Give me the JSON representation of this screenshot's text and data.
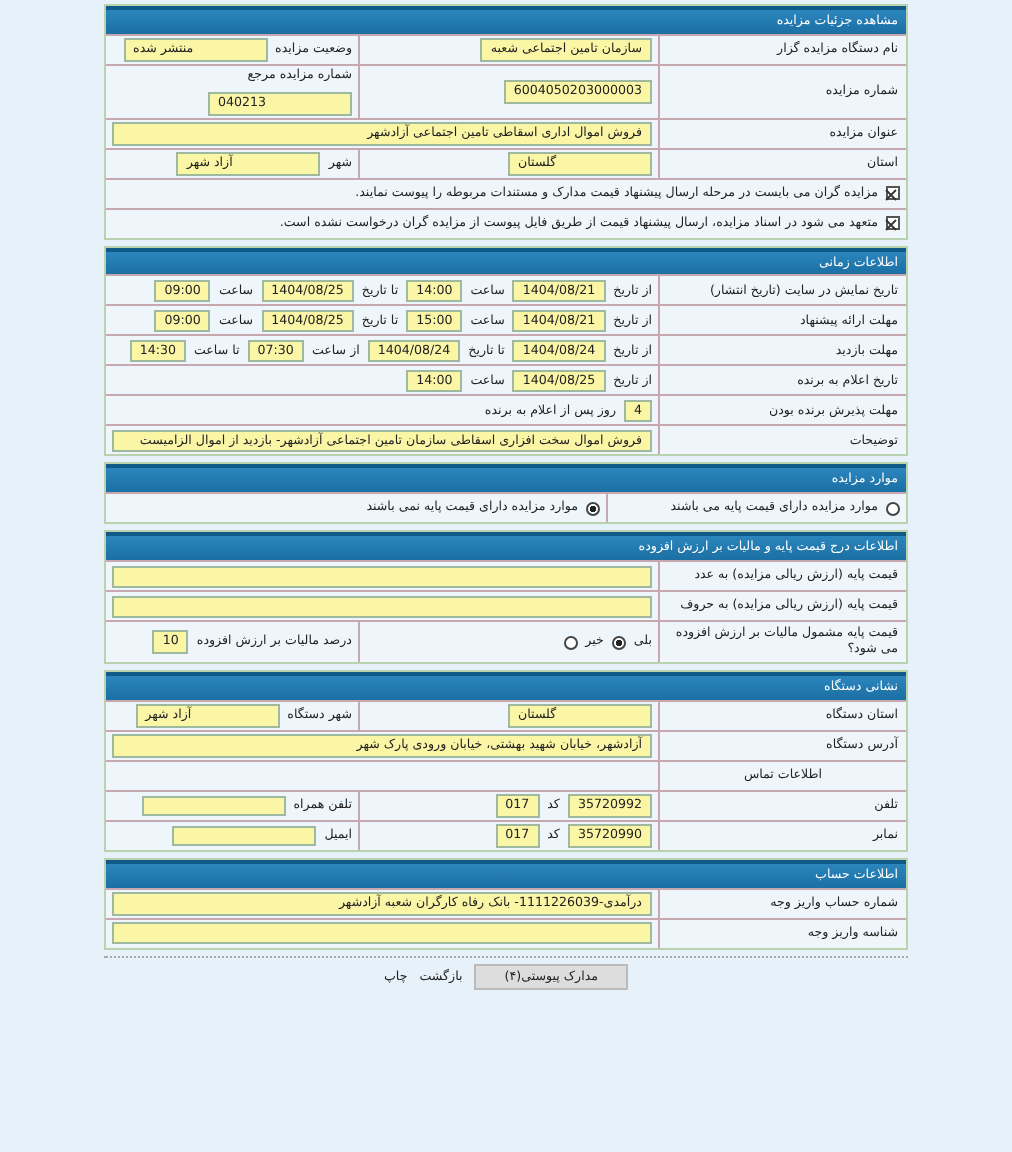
{
  "sections": [
    {
      "title": "مشاهده جزئیات مزایده",
      "rows": [
        {
          "kind": "fields",
          "label": "نام دستگاه مزایده گزار",
          "cells": [
            [
              {
                "kind": "field",
                "value": "سازمان تامین اجتماعی شعبه"
              }
            ],
            [
              {
                "kind": "text",
                "text": "وضعیت مزایده"
              },
              {
                "kind": "field",
                "value": "منتشر شده"
              }
            ]
          ]
        },
        {
          "kind": "fields",
          "label": "شماره مزایده",
          "cells": [
            [
              {
                "kind": "field",
                "value": "6004050203000003"
              }
            ],
            [
              {
                "kind": "text",
                "text": "شماره مزایده مرجع"
              },
              {
                "kind": "field",
                "value": "040213"
              }
            ]
          ]
        },
        {
          "kind": "fields",
          "label": "عنوان مزایده",
          "cells": [
            [
              {
                "kind": "field",
                "value": "فروش اموال اداری اسقاطی تامین اجتماعی آزادشهر"
              }
            ]
          ]
        },
        {
          "kind": "fields",
          "label": "استان",
          "cells": [
            [
              {
                "kind": "field",
                "value": "گلستان"
              }
            ],
            [
              {
                "kind": "text",
                "text": "شهر"
              },
              {
                "kind": "field",
                "value": "آزاد شهر"
              }
            ]
          ]
        },
        {
          "kind": "fields",
          "cells": [
            [
              {
                "kind": "check",
                "checked": true
              },
              {
                "kind": "text",
                "text": "مزایده گران می بایست در مرحله ارسال پیشنهاد قیمت مدارک و مستندات مربوطه را پیوست نمایند."
              }
            ]
          ]
        },
        {
          "kind": "fields",
          "cells": [
            [
              {
                "kind": "check",
                "checked": true
              },
              {
                "kind": "text",
                "text": "متعهد می شود در اسناد مزایده، ارسال پیشنهاد قیمت از طریق فایل پیوست از مزایده گران درخواست نشده است."
              }
            ]
          ]
        }
      ]
    },
    {
      "title": "اطلاعات زمانی",
      "rows": [
        {
          "kind": "fields",
          "label": "تاریخ نمایش در سایت (تاریخ انتشار)",
          "cells": [
            [
              {
                "kind": "text",
                "text": "از تاریخ"
              },
              {
                "kind": "field",
                "value": "1404/08/21"
              },
              {
                "kind": "text",
                "text": "ساعت"
              },
              {
                "kind": "field",
                "value": "14:00"
              },
              {
                "kind": "text",
                "text": "تا تاریخ"
              },
              {
                "kind": "field",
                "value": "1404/08/25"
              },
              {
                "kind": "text",
                "text": "ساعت"
              },
              {
                "kind": "field",
                "value": "09:00"
              }
            ]
          ]
        },
        {
          "kind": "fields",
          "label": "مهلت ارائه پیشنهاد",
          "cells": [
            [
              {
                "kind": "text",
                "text": "از تاریخ"
              },
              {
                "kind": "field",
                "value": "1404/08/21"
              },
              {
                "kind": "text",
                "text": "ساعت"
              },
              {
                "kind": "field",
                "value": "15:00"
              },
              {
                "kind": "text",
                "text": "تا تاریخ"
              },
              {
                "kind": "field",
                "value": "1404/08/25"
              },
              {
                "kind": "text",
                "text": "ساعت"
              },
              {
                "kind": "field",
                "value": "09:00"
              }
            ]
          ]
        },
        {
          "kind": "fields",
          "label": "مهلت بازدید",
          "cells": [
            [
              {
                "kind": "text",
                "text": "از تاریخ"
              },
              {
                "kind": "field",
                "value": "1404/08/24"
              },
              {
                "kind": "text",
                "text": "تا تاریخ"
              },
              {
                "kind": "field",
                "value": "1404/08/24"
              },
              {
                "kind": "text",
                "text": "از ساعت"
              },
              {
                "kind": "field",
                "value": "07:30"
              },
              {
                "kind": "text",
                "text": "تا ساعت"
              },
              {
                "kind": "field",
                "value": "14:30"
              }
            ]
          ]
        },
        {
          "kind": "fields",
          "label": "تاریخ اعلام به برنده",
          "cells": [
            [
              {
                "kind": "text",
                "text": "از تاریخ"
              },
              {
                "kind": "field",
                "value": "1404/08/25"
              },
              {
                "kind": "text",
                "text": "ساعت"
              },
              {
                "kind": "field",
                "value": "14:00"
              }
            ]
          ]
        },
        {
          "kind": "fields",
          "label": "مهلت پذیرش برنده بودن",
          "cells": [
            [
              {
                "kind": "field",
                "value": "4"
              },
              {
                "kind": "text",
                "text": "روز پس از اعلام به برنده"
              }
            ]
          ]
        },
        {
          "kind": "fields",
          "label": "توضیحات",
          "cells": [
            [
              {
                "kind": "field",
                "value": "فروش اموال سخت افزاری اسقاطی سازمان تامین اجتماعی آزادشهر- بازدید از اموال الزامیست"
              }
            ]
          ]
        }
      ]
    },
    {
      "title": "موارد مزایده",
      "rows": [
        {
          "kind": "fields",
          "cells": [
            [
              {
                "kind": "radio",
                "selected": false
              },
              {
                "kind": "text",
                "text": "موارد مزایده دارای قیمت پایه می باشند"
              }
            ],
            [
              {
                "kind": "radio",
                "selected": true
              },
              {
                "kind": "text",
                "text": "موارد مزایده دارای قیمت پایه نمی باشند"
              }
            ]
          ]
        }
      ]
    },
    {
      "title": "اطلاعات درج قیمت پایه و مالیات بر ارزش افزوده",
      "rows": [
        {
          "kind": "fields",
          "label": "قیمت پایه (ارزش ریالی مزایده) به عدد",
          "cells": [
            [
              {
                "kind": "field"
              }
            ]
          ]
        },
        {
          "kind": "fields",
          "label": "قیمت پایه (ارزش ریالی مزایده) به حروف",
          "cells": [
            [
              {
                "kind": "field"
              }
            ]
          ]
        },
        {
          "kind": "fields",
          "label": "قیمت پایه مشمول مالیات بر ارزش افزوده می شود؟",
          "cells": [
            [
              {
                "kind": "text",
                "text": "بلی"
              },
              {
                "kind": "radio",
                "selected": true
              },
              {
                "kind": "text",
                "text": "خیر"
              },
              {
                "kind": "radio",
                "selected": false
              }
            ],
            [
              {
                "kind": "text",
                "text": "درصد مالیات بر ارزش افزوده"
              },
              {
                "kind": "field",
                "value": "10"
              }
            ]
          ]
        }
      ]
    },
    {
      "title": "نشانی دستگاه",
      "rows": [
        {
          "kind": "fields",
          "label": "استان دستگاه",
          "cells": [
            [
              {
                "kind": "field",
                "value": "گلستان"
              }
            ],
            [
              {
                "kind": "text",
                "text": "شهر دستگاه"
              },
              {
                "kind": "field",
                "value": "آزاد شهر"
              }
            ]
          ]
        },
        {
          "kind": "fields",
          "label": "آدرس دستگاه",
          "cells": [
            [
              {
                "kind": "field",
                "value": "آزادشهر، خیابان شهید بهشتی، خیابان ورودی پارک شهر"
              }
            ]
          ]
        },
        {
          "kind": "subhead",
          "label": "اطلاعات تماس"
        },
        {
          "kind": "fields",
          "label": "تلفن",
          "cells": [
            [
              {
                "kind": "field",
                "value": "35720992"
              },
              {
                "kind": "text",
                "text": "کد"
              },
              {
                "kind": "field",
                "value": "017"
              }
            ],
            [
              {
                "kind": "text",
                "text": "تلفن همراه"
              },
              {
                "kind": "field"
              }
            ]
          ]
        },
        {
          "kind": "fields",
          "label": "نمابر",
          "cells": [
            [
              {
                "kind": "field",
                "value": "35720990"
              },
              {
                "kind": "text",
                "text": "کد"
              },
              {
                "kind": "field",
                "value": "017"
              }
            ],
            [
              {
                "kind": "text",
                "text": "ایمیل"
              },
              {
                "kind": "field"
              }
            ]
          ]
        }
      ]
    },
    {
      "title": "اطلاعات حساب",
      "rows": [
        {
          "kind": "fields",
          "label": "شماره حساب واریز وجه",
          "cells": [
            [
              {
                "kind": "field",
                "value": "درآمدی-1111226039- بانک رفاه کارگران شعبه آزادشهر"
              }
            ]
          ]
        },
        {
          "kind": "fields",
          "label": "شناسه واریز وجه",
          "cells": [
            [
              {
                "kind": "field"
              }
            ]
          ]
        }
      ]
    }
  ],
  "footer": {
    "button": "مدارک پیوستی(۴)",
    "links": [
      "بازگشت",
      "چاپ"
    ]
  }
}
